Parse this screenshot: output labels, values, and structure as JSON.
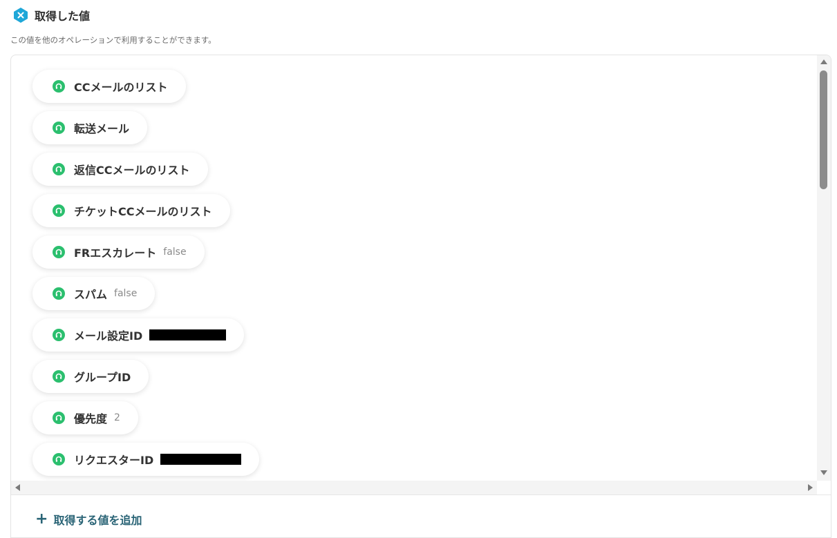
{
  "header": {
    "title": "取得した値",
    "icon": "x-variable-icon",
    "subtitle": "この値を他のオペレーションで利用することができます。"
  },
  "colors": {
    "accent": "#1fa7d8",
    "pill_icon": "#2bbf6e",
    "add_link": "#2a6476"
  },
  "values": [
    {
      "label": "CCメールのリスト",
      "value": "",
      "redacted": false
    },
    {
      "label": "転送メール",
      "value": "",
      "redacted": false
    },
    {
      "label": "返信CCメールのリスト",
      "value": "",
      "redacted": false
    },
    {
      "label": "チケットCCメールのリスト",
      "value": "",
      "redacted": false
    },
    {
      "label": "FRエスカレート",
      "value": "false",
      "redacted": false
    },
    {
      "label": "スパム",
      "value": "false",
      "redacted": false
    },
    {
      "label": "メール設定ID",
      "value": "",
      "redacted": true
    },
    {
      "label": "グループID",
      "value": "",
      "redacted": false
    },
    {
      "label": "優先度",
      "value": "2",
      "redacted": false
    },
    {
      "label": "リクエスターID",
      "value": "",
      "redacted": true
    }
  ],
  "pill_icon": "headset-icon",
  "add_button": {
    "label": "取得する値を追加",
    "icon": "plus-icon"
  }
}
